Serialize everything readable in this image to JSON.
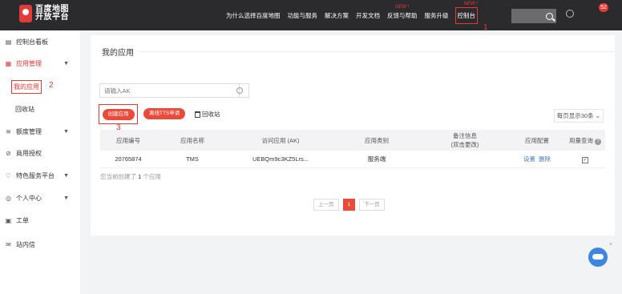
{
  "header": {
    "logo_line1": "百度地图",
    "logo_line2": "开放平台",
    "nav": [
      {
        "label": "为什么选择百度地图",
        "new": ""
      },
      {
        "label": "功能与服务",
        "new": ""
      },
      {
        "label": "解决方案",
        "new": ""
      },
      {
        "label": "开发文档",
        "new": ""
      },
      {
        "label": "反馈与帮助",
        "new": "NEW !"
      },
      {
        "label": "服务升级",
        "new": ""
      },
      {
        "label": "控制台",
        "new": "NEW !"
      }
    ],
    "annotation_1": "1",
    "notification_count": "52"
  },
  "sidebar": {
    "items": [
      {
        "icon": "dashboard-icon",
        "label": "控制台看板"
      },
      {
        "icon": "apps-icon",
        "label": "应用管理"
      },
      {
        "icon": "quota-icon",
        "label": "额度管理"
      },
      {
        "icon": "shield-icon",
        "label": "商用授权"
      },
      {
        "icon": "heart-icon",
        "label": "特色服务平台"
      },
      {
        "icon": "user-icon",
        "label": "个人中心"
      },
      {
        "icon": "ticket-icon",
        "label": "工单"
      },
      {
        "icon": "mail-icon",
        "label": "站内信"
      }
    ],
    "sub_my_apps": "我的应用",
    "sub_recycle": "回收站",
    "annotation_2": "2"
  },
  "main": {
    "title": "我的应用",
    "ak_placeholder": "请输入AK",
    "create_button": "创建应用",
    "tts_button": "离线TTS申请",
    "recycle_link": "回收站",
    "annotation_3": "3",
    "per_page": "每页显示30条",
    "table": {
      "headers": [
        "应用编号",
        "应用名称",
        "访问应用 (AK)",
        "应用类别",
        "备注信息",
        "应用配置",
        "用量查询"
      ],
      "remark_sub": "(双击更改)",
      "rows": [
        {
          "id": "20765874",
          "name": "TMS",
          "ak": "UEBQm9c3KZ5Lrs...",
          "type": "服务端",
          "remark": "",
          "config_set": "设置",
          "config_delete": "删除"
        }
      ]
    },
    "count_prefix": "您当前创建了",
    "count_value": "1",
    "count_suffix": "个应用",
    "pager": {
      "prev": "上一页",
      "current": "1",
      "next": "下一页"
    }
  }
}
